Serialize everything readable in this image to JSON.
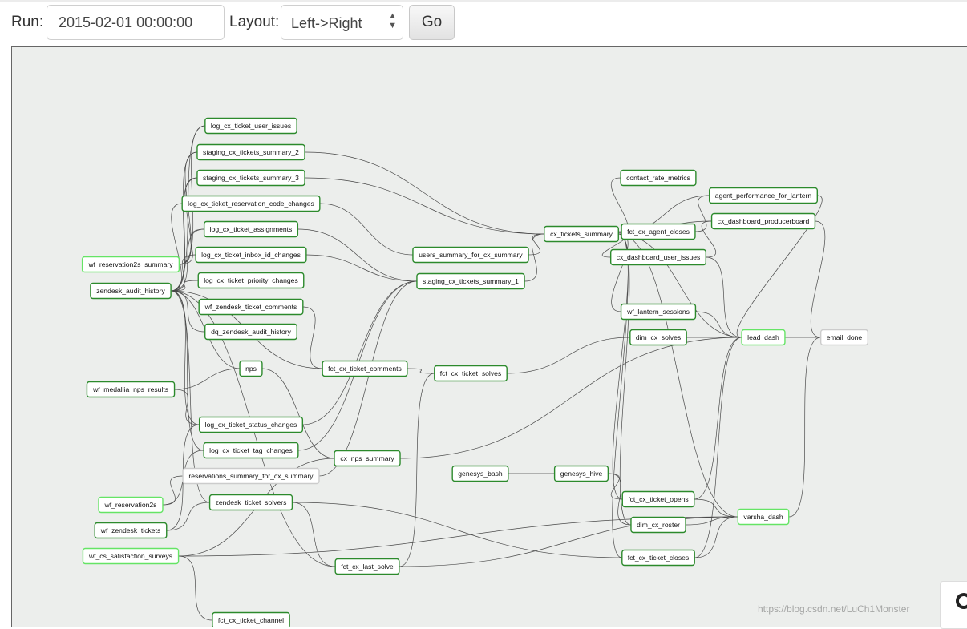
{
  "toolbar": {
    "run_label": "Run:",
    "run_value": "2015-02-01 00:00:00",
    "layout_label": "Layout:",
    "layout_value": "Left->Right",
    "go_label": "Go"
  },
  "graph": {
    "colors": {
      "background": "#eceeec",
      "success": "#2c8a2c",
      "running": "#65e465",
      "no_status": "#cccccc"
    },
    "nodes": [
      {
        "id": "log_cx_ticket_user_issues",
        "label": "log_cx_ticket_user_issues",
        "status": "success"
      },
      {
        "id": "staging_cx_tickets_summary_2",
        "label": "staging_cx_tickets_summary_2",
        "status": "success"
      },
      {
        "id": "staging_cx_tickets_summary_3",
        "label": "staging_cx_tickets_summary_3",
        "status": "success"
      },
      {
        "id": "log_cx_ticket_reservation_code_changes",
        "label": "log_cx_ticket_reservation_code_changes",
        "status": "success"
      },
      {
        "id": "log_cx_ticket_assignments",
        "label": "log_cx_ticket_assignments",
        "status": "success"
      },
      {
        "id": "log_cx_ticket_inbox_id_changes",
        "label": "log_cx_ticket_inbox_id_changes",
        "status": "success"
      },
      {
        "id": "log_cx_ticket_priority_changes",
        "label": "log_cx_ticket_priority_changes",
        "status": "success"
      },
      {
        "id": "wf_zendesk_ticket_comments",
        "label": "wf_zendesk_ticket_comments",
        "status": "success"
      },
      {
        "id": "dq_zendesk_audit_history",
        "label": "dq_zendesk_audit_history",
        "status": "success"
      },
      {
        "id": "wf_reservation2s_summary",
        "label": "wf_reservation2s_summary",
        "status": "running"
      },
      {
        "id": "zendesk_audit_history",
        "label": "zendesk_audit_history",
        "status": "success"
      },
      {
        "id": "nps",
        "label": "nps",
        "status": "success"
      },
      {
        "id": "fct_cx_ticket_comments",
        "label": "fct_cx_ticket_comments",
        "status": "success"
      },
      {
        "id": "wf_medallia_nps_results",
        "label": "wf_medallia_nps_results",
        "status": "success"
      },
      {
        "id": "log_cx_ticket_status_changes",
        "label": "log_cx_ticket_status_changes",
        "status": "success"
      },
      {
        "id": "log_cx_ticket_tag_changes",
        "label": "log_cx_ticket_tag_changes",
        "status": "success"
      },
      {
        "id": "reservations_summary_for_cx_summary",
        "label": "reservations_summary_for_cx_summary",
        "status": "none"
      },
      {
        "id": "wf_reservation2s",
        "label": "wf_reservation2s",
        "status": "running"
      },
      {
        "id": "zendesk_ticket_solvers",
        "label": "zendesk_ticket_solvers",
        "status": "success"
      },
      {
        "id": "wf_zendesk_tickets",
        "label": "wf_zendesk_tickets",
        "status": "success"
      },
      {
        "id": "wf_cs_satisfaction_surveys",
        "label": "wf_cs_satisfaction_surveys",
        "status": "running"
      },
      {
        "id": "fct_cx_ticket_channel",
        "label": "fct_cx_ticket_channel",
        "status": "success"
      },
      {
        "id": "users_summary_for_cx_summary",
        "label": "users_summary_for_cx_summary",
        "status": "success"
      },
      {
        "id": "staging_cx_tickets_summary_1",
        "label": "staging_cx_tickets_summary_1",
        "status": "success"
      },
      {
        "id": "fct_cx_ticket_solves",
        "label": "fct_cx_ticket_solves",
        "status": "success"
      },
      {
        "id": "cx_nps_summary",
        "label": "cx_nps_summary",
        "status": "success"
      },
      {
        "id": "genesys_bash",
        "label": "genesys_bash",
        "status": "success"
      },
      {
        "id": "genesys_hive",
        "label": "genesys_hive",
        "status": "success"
      },
      {
        "id": "fct_cx_last_solve",
        "label": "fct_cx_last_solve",
        "status": "success"
      },
      {
        "id": "cx_tickets_summary",
        "label": "cx_tickets_summary",
        "status": "success"
      },
      {
        "id": "contact_rate_metrics",
        "label": "contact_rate_metrics",
        "status": "success"
      },
      {
        "id": "agent_performance_for_lantern",
        "label": "agent_performance_for_lantern",
        "status": "success"
      },
      {
        "id": "fct_cx_agent_closes",
        "label": "fct_cx_agent_closes",
        "status": "success"
      },
      {
        "id": "cx_dashboard_producerboard",
        "label": "cx_dashboard_producerboard",
        "status": "success"
      },
      {
        "id": "cx_dashboard_user_issues",
        "label": "cx_dashboard_user_issues",
        "status": "success"
      },
      {
        "id": "wf_lantern_sessions",
        "label": "wf_lantern_sessions",
        "status": "success"
      },
      {
        "id": "dim_cx_solves",
        "label": "dim_cx_solves",
        "status": "success"
      },
      {
        "id": "lead_dash",
        "label": "lead_dash",
        "status": "running"
      },
      {
        "id": "email_done",
        "label": "email_done",
        "status": "none"
      },
      {
        "id": "fct_cx_ticket_opens",
        "label": "fct_cx_ticket_opens",
        "status": "success"
      },
      {
        "id": "dim_cx_roster",
        "label": "dim_cx_roster",
        "status": "success"
      },
      {
        "id": "varsha_dash",
        "label": "varsha_dash",
        "status": "running"
      },
      {
        "id": "fct_cx_ticket_closes",
        "label": "fct_cx_ticket_closes",
        "status": "success"
      }
    ],
    "edges": [
      [
        "zendesk_audit_history",
        "log_cx_ticket_user_issues"
      ],
      [
        "zendesk_audit_history",
        "staging_cx_tickets_summary_2"
      ],
      [
        "zendesk_audit_history",
        "staging_cx_tickets_summary_3"
      ],
      [
        "zendesk_audit_history",
        "log_cx_ticket_reservation_code_changes"
      ],
      [
        "zendesk_audit_history",
        "log_cx_ticket_assignments"
      ],
      [
        "zendesk_audit_history",
        "log_cx_ticket_inbox_id_changes"
      ],
      [
        "zendesk_audit_history",
        "log_cx_ticket_priority_changes"
      ],
      [
        "zendesk_audit_history",
        "dq_zendesk_audit_history"
      ],
      [
        "zendesk_audit_history",
        "nps"
      ],
      [
        "zendesk_audit_history",
        "log_cx_ticket_status_changes"
      ],
      [
        "zendesk_audit_history",
        "log_cx_ticket_tag_changes"
      ],
      [
        "zendesk_audit_history",
        "zendesk_ticket_solvers"
      ],
      [
        "zendesk_audit_history",
        "fct_cx_last_solve"
      ],
      [
        "wf_reservation2s_summary",
        "log_cx_ticket_user_issues"
      ],
      [
        "wf_reservation2s_summary",
        "staging_cx_tickets_summary_2"
      ],
      [
        "wf_reservation2s_summary",
        "staging_cx_tickets_summary_3"
      ],
      [
        "wf_reservation2s_summary",
        "log_cx_ticket_assignments"
      ],
      [
        "wf_medallia_nps_results",
        "nps"
      ],
      [
        "wf_medallia_nps_results",
        "log_cx_ticket_status_changes"
      ],
      [
        "wf_zendesk_ticket_comments",
        "fct_cx_ticket_comments"
      ],
      [
        "nps",
        "cx_nps_summary"
      ],
      [
        "zendesk_audit_history",
        "fct_cx_ticket_comments"
      ],
      [
        "log_cx_ticket_reservation_code_changes",
        "users_summary_for_cx_summary"
      ],
      [
        "log_cx_ticket_assignments",
        "staging_cx_tickets_summary_1"
      ],
      [
        "log_cx_ticket_inbox_id_changes",
        "staging_cx_tickets_summary_1"
      ],
      [
        "staging_cx_tickets_summary_2",
        "cx_tickets_summary"
      ],
      [
        "staging_cx_tickets_summary_3",
        "cx_tickets_summary"
      ],
      [
        "log_cx_ticket_status_changes",
        "staging_cx_tickets_summary_1"
      ],
      [
        "log_cx_ticket_tag_changes",
        "staging_cx_tickets_summary_1"
      ],
      [
        "users_summary_for_cx_summary",
        "cx_tickets_summary"
      ],
      [
        "staging_cx_tickets_summary_1",
        "cx_tickets_summary"
      ],
      [
        "fct_cx_ticket_comments",
        "fct_cx_ticket_solves"
      ],
      [
        "wf_zendesk_tickets",
        "log_cx_ticket_status_changes"
      ],
      [
        "wf_zendesk_tickets",
        "zendesk_ticket_solvers"
      ],
      [
        "wf_reservation2s",
        "reservations_summary_for_cx_summary"
      ],
      [
        "wf_reservation2s",
        "log_cx_ticket_tag_changes"
      ],
      [
        "reservations_summary_for_cx_summary",
        "staging_cx_tickets_summary_1"
      ],
      [
        "zendesk_ticket_solvers",
        "fct_cx_last_solve"
      ],
      [
        "zendesk_ticket_solvers",
        "fct_cx_ticket_closes"
      ],
      [
        "wf_cs_satisfaction_surveys",
        "cx_nps_summary"
      ],
      [
        "wf_cs_satisfaction_surveys",
        "fct_cx_ticket_channel"
      ],
      [
        "wf_cs_satisfaction_surveys",
        "varsha_dash"
      ],
      [
        "fct_cx_last_solve",
        "fct_cx_ticket_solves"
      ],
      [
        "fct_cx_last_solve",
        "varsha_dash"
      ],
      [
        "cx_nps_summary",
        "lead_dash"
      ],
      [
        "fct_cx_ticket_solves",
        "dim_cx_solves"
      ],
      [
        "genesys_bash",
        "genesys_hive"
      ],
      [
        "genesys_hive",
        "fct_cx_ticket_opens"
      ],
      [
        "genesys_hive",
        "dim_cx_roster"
      ],
      [
        "cx_tickets_summary",
        "contact_rate_metrics"
      ],
      [
        "cx_tickets_summary",
        "agent_performance_for_lantern"
      ],
      [
        "cx_tickets_summary",
        "fct_cx_agent_closes"
      ],
      [
        "cx_tickets_summary",
        "cx_dashboard_producerboard"
      ],
      [
        "cx_tickets_summary",
        "cx_dashboard_user_issues"
      ],
      [
        "cx_tickets_summary",
        "wf_lantern_sessions"
      ],
      [
        "cx_tickets_summary",
        "lead_dash"
      ],
      [
        "cx_tickets_summary",
        "fct_cx_ticket_opens"
      ],
      [
        "cx_tickets_summary",
        "dim_cx_roster"
      ],
      [
        "cx_tickets_summary",
        "fct_cx_ticket_closes"
      ],
      [
        "cx_tickets_summary",
        "varsha_dash"
      ],
      [
        "fct_cx_agent_closes",
        "agent_performance_for_lantern"
      ],
      [
        "cx_dashboard_user_issues",
        "cx_dashboard_producerboard"
      ],
      [
        "cx_dashboard_user_issues",
        "lead_dash"
      ],
      [
        "wf_lantern_sessions",
        "lead_dash"
      ],
      [
        "dim_cx_solves",
        "lead_dash"
      ],
      [
        "lead_dash",
        "email_done"
      ],
      [
        "cx_dashboard_producerboard",
        "email_done"
      ],
      [
        "agent_performance_for_lantern",
        "lead_dash"
      ],
      [
        "fct_cx_ticket_opens",
        "lead_dash"
      ],
      [
        "fct_cx_ticket_opens",
        "varsha_dash"
      ],
      [
        "dim_cx_roster",
        "varsha_dash"
      ],
      [
        "fct_cx_ticket_closes",
        "varsha_dash"
      ],
      [
        "fct_cx_ticket_closes",
        "lead_dash"
      ],
      [
        "varsha_dash",
        "email_done"
      ]
    ]
  },
  "watermark": "https://blog.csdn.net/LuCh1Monster"
}
